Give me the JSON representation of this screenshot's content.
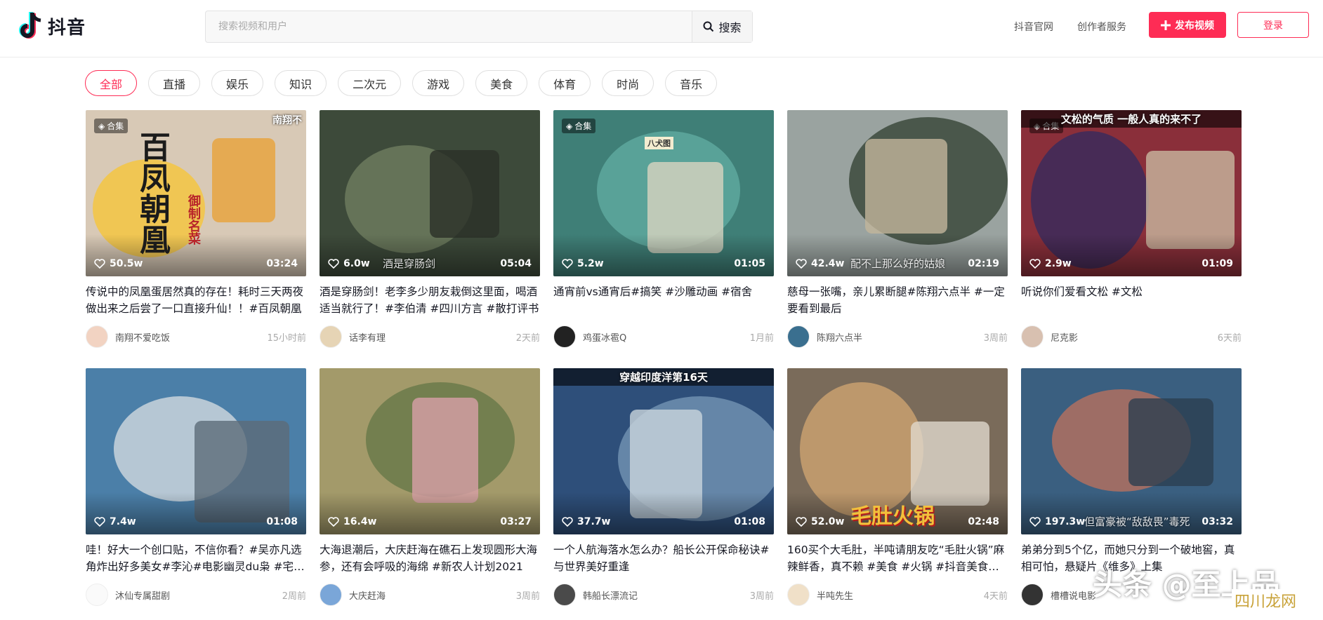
{
  "header": {
    "logo_text": "抖音",
    "search_placeholder": "搜索视频和用户",
    "search_button": "搜索",
    "nav_official": "抖音官网",
    "nav_creator": "创作者服务",
    "upload_button": "发布视频",
    "login_button": "登录",
    "colors": {
      "accent": "#fe2c55"
    }
  },
  "categories": [
    "全部",
    "直播",
    "娱乐",
    "知识",
    "二次元",
    "游戏",
    "美食",
    "体育",
    "时尚",
    "音乐"
  ],
  "active_category": "全部",
  "videos": [
    {
      "title": "传说中的凤凰蛋居然真的存在！耗时三天两夜做出来之后尝了一口直接升仙！！#百凤朝凰",
      "likes": "50.5w",
      "duration": "03:24",
      "author": "南翔不爱吃饭",
      "time": "15小时前",
      "badge": "合集",
      "overlay": "南翔不",
      "overlay2": "百凤朝凰",
      "overlay3": "御制名菜"
    },
    {
      "title": "酒是穿肠剑！老李多少朋友栽倒这里面，喝酒适当就行了！#李伯清 #四川方言 #散打评书",
      "likes": "6.0w",
      "duration": "05:04",
      "author": "话李有理",
      "time": "2天前",
      "badge": "",
      "overlay": "酒是穿肠剑"
    },
    {
      "title": "通宵前vs通宵后#搞笑 #沙雕动画 #宿舍",
      "likes": "5.2w",
      "duration": "01:05",
      "author": "鸡蛋冰雹Q",
      "time": "1月前",
      "badge": "合集",
      "overlay": "八犬图"
    },
    {
      "title": "慈母一张嘴，亲儿累断腿#陈翔六点半 #一定要看到最后",
      "likes": "42.4w",
      "duration": "02:19",
      "author": "陈翔六点半",
      "time": "3周前",
      "badge": "",
      "overlay": "配不上那么好的姑娘"
    },
    {
      "title": "听说你们爱看文松 #文松",
      "likes": "2.9w",
      "duration": "01:09",
      "author": "尼克影",
      "time": "6天前",
      "badge": "合集",
      "overlay": "文松的气质  一般人真的来不了"
    },
    {
      "title": "哇！好大一个创口贴，不信你看？#吴亦凡选角炸出好多美女#李沁#电影幽灵du枭 #宅男女神",
      "likes": "7.4w",
      "duration": "01:08",
      "author": "沐仙专属甜剧",
      "time": "2周前",
      "badge": "",
      "overlay": ""
    },
    {
      "title": "大海退潮后，大庆赶海在礁石上发现圆形大海参，还有会呼吸的海绵 #新农人计划2021",
      "likes": "16.4w",
      "duration": "03:27",
      "author": "大庆赶海",
      "time": "3周前",
      "badge": "",
      "overlay": ""
    },
    {
      "title": "一个人航海落水怎么办？船长公开保命秘诀#与世界美好重逢",
      "likes": "37.7w",
      "duration": "01:08",
      "author": "韩船长漂流记",
      "time": "3周前",
      "badge": "",
      "overlay": "穿越印度洋第16天"
    },
    {
      "title": "160买个大毛肚，半吨请朋友吃“毛肚火锅”麻辣鲜香，真不赖 #美食 #火锅 #抖音美食推荐官",
      "likes": "52.0w",
      "duration": "02:48",
      "author": "半吨先生",
      "time": "4天前",
      "badge": "",
      "overlay": "毛肚火锅"
    },
    {
      "title": "弟弟分到5个亿，而她只分到一个破地窖，真相可怕，悬疑片《维多》上集",
      "likes": "197.3w",
      "duration": "03:32",
      "author": "槽槽说电影",
      "time": "",
      "badge": "",
      "overlay": "但富豪被“敌敌畏”毒死"
    }
  ],
  "watermark": "头条 @至上品",
  "watermark_site": "四川龙网"
}
